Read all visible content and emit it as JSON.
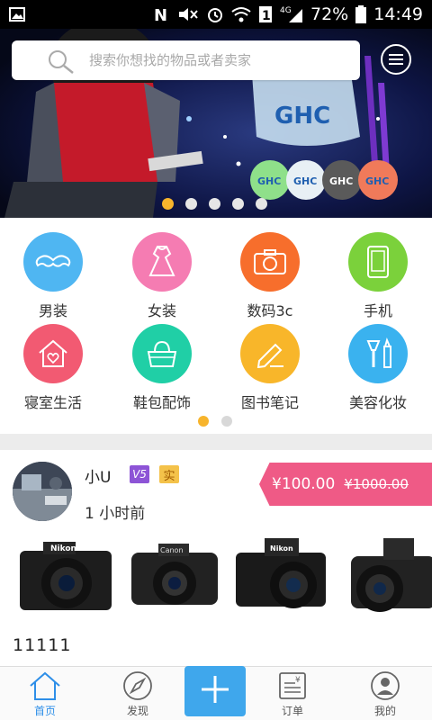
{
  "status_bar": {
    "battery_percent": "72%",
    "time": "14:49",
    "network": "4G",
    "sim": "1"
  },
  "search": {
    "placeholder": "搜索你想找的物品或者卖家"
  },
  "banner": {
    "brand_text": "GHC",
    "slide_count": 5,
    "active_slide": 0
  },
  "categories": [
    {
      "label": "男装",
      "icon": "mustache-icon",
      "color": "#4fb6f2"
    },
    {
      "label": "女装",
      "icon": "dress-icon",
      "color": "#f57cb2"
    },
    {
      "label": "数码3c",
      "icon": "camera-icon",
      "color": "#f76e2c"
    },
    {
      "label": "手机",
      "icon": "phone-icon",
      "color": "#7bd13b"
    },
    {
      "label": "寝室生活",
      "icon": "home-heart-icon",
      "color": "#f25a72"
    },
    {
      "label": "鞋包配饰",
      "icon": "handbag-icon",
      "color": "#20cfa6"
    },
    {
      "label": "图书笔记",
      "icon": "pencil-note-icon",
      "color": "#f8b62a"
    },
    {
      "label": "美容化妆",
      "icon": "cosmetics-icon",
      "color": "#3ab2ef"
    }
  ],
  "category_pages": {
    "count": 2,
    "active": 0
  },
  "post": {
    "username": "小U",
    "badge_level": "V5",
    "badge_real": "实",
    "time": "1 小时前",
    "price": "¥100.00",
    "original_price": "¥1000.00",
    "description": "11111",
    "photos": [
      "camera-photo-1",
      "camera-photo-2",
      "camera-photo-3",
      "camera-photo-4"
    ]
  },
  "tabbar": {
    "items": [
      {
        "label": "首页",
        "icon": "home-icon",
        "active": true
      },
      {
        "label": "发现",
        "icon": "compass-icon",
        "active": false
      },
      {
        "label": "",
        "icon": "plus-icon",
        "active": false
      },
      {
        "label": "订单",
        "icon": "order-icon",
        "active": false
      },
      {
        "label": "我的",
        "icon": "user-icon",
        "active": false
      }
    ]
  },
  "colors": {
    "accent": "#2e8fe8",
    "price_tag": "#ef5a86",
    "dot_active": "#f7b42c",
    "add_button": "#3fa7ec"
  }
}
